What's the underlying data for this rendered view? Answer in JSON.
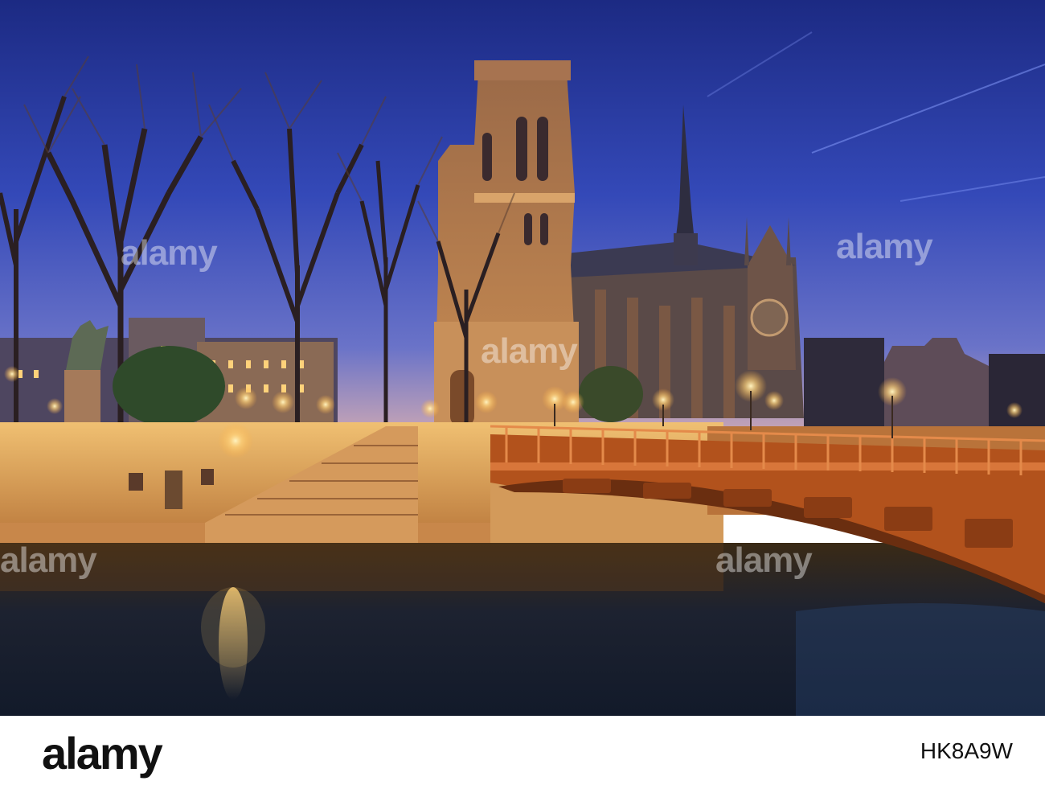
{
  "photo": {
    "subject": "",
    "watermark_text": "alamy"
  },
  "footer": {
    "logo": "alamy",
    "image_id": "HK8A9W"
  },
  "colors": {
    "sky_top": "#1f2f8c",
    "sky_mid": "#3f57c8",
    "sky_horizon": "#8a86c9",
    "stone_lit": "#e6a75a",
    "water": "#1b2536",
    "bridge": "#b8561e",
    "lamp": "#ffe49a"
  }
}
